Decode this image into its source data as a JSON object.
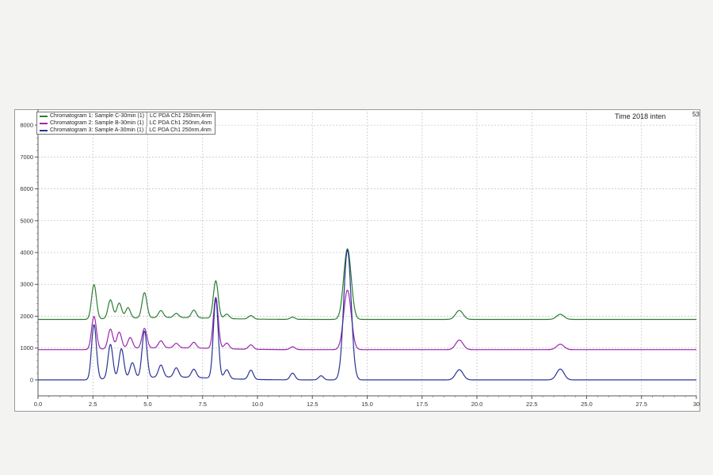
{
  "title": "Time 2018  inten",
  "corner_label": "53",
  "legend": [
    {
      "name": "Chromatogram 1: Sample C-30min (1)",
      "detail": "LC PDA Ch1 250nm,4nm",
      "color": "#2e7d32"
    },
    {
      "name": "Chromatogram 2: Sample B-30min (1)",
      "detail": "LC PDA Ch1 250nm,4nm",
      "color": "#9c27b0"
    },
    {
      "name": "Chromatogram 3: Sample A-30min (1)",
      "detail": "LC PDA Ch1 250nm,4nm",
      "color": "#283593"
    }
  ],
  "chart_data": {
    "type": "line",
    "title": "Time 2018  inten",
    "xlabel": "",
    "ylabel": "",
    "xlim": [
      0,
      30
    ],
    "ylim": [
      -500,
      8500
    ],
    "x_ticks": [
      "0.0",
      "2.5",
      "5.0",
      "7.5",
      "10.0",
      "12.5",
      "15.0",
      "17.5",
      "20.0",
      "22.5",
      "25.0",
      "27.5",
      "30"
    ],
    "y_ticks": [
      "0",
      "1000",
      "2000",
      "3000",
      "4000",
      "5000",
      "6000",
      "7000",
      "8000"
    ],
    "grid": true,
    "legend_position": "top-left",
    "series": [
      {
        "name": "Chromatogram 1: Sample C-30min (1)",
        "color": "#2e7d32",
        "baseline": 1900,
        "peaks": [
          {
            "t": 2.55,
            "h": 1080
          },
          {
            "t": 3.3,
            "h": 590
          },
          {
            "t": 3.7,
            "h": 480
          },
          {
            "t": 4.1,
            "h": 330
          },
          {
            "t": 4.85,
            "h": 790
          },
          {
            "t": 5.6,
            "h": 220
          },
          {
            "t": 6.3,
            "h": 130
          },
          {
            "t": 7.1,
            "h": 240
          },
          {
            "t": 8.1,
            "h": 1180
          },
          {
            "t": 8.6,
            "h": 140
          },
          {
            "t": 9.7,
            "h": 110
          },
          {
            "t": 11.6,
            "h": 70
          },
          {
            "t": 14.1,
            "h": 2220
          },
          {
            "t": 19.2,
            "h": 280
          },
          {
            "t": 23.8,
            "h": 160
          }
        ]
      },
      {
        "name": "Chromatogram 2: Sample B-30min (1)",
        "color": "#9c27b0",
        "baseline": 950,
        "peaks": [
          {
            "t": 2.55,
            "h": 1030
          },
          {
            "t": 3.3,
            "h": 620
          },
          {
            "t": 3.7,
            "h": 520
          },
          {
            "t": 4.2,
            "h": 340
          },
          {
            "t": 4.85,
            "h": 620
          },
          {
            "t": 5.6,
            "h": 220
          },
          {
            "t": 6.3,
            "h": 140
          },
          {
            "t": 7.1,
            "h": 180
          },
          {
            "t": 8.1,
            "h": 1610
          },
          {
            "t": 8.6,
            "h": 180
          },
          {
            "t": 9.7,
            "h": 140
          },
          {
            "t": 11.6,
            "h": 90
          },
          {
            "t": 14.1,
            "h": 1870
          },
          {
            "t": 19.2,
            "h": 300
          },
          {
            "t": 23.8,
            "h": 170
          }
        ]
      },
      {
        "name": "Chromatogram 3: Sample A-30min (1)",
        "color": "#283593",
        "baseline": 0,
        "peaks": [
          {
            "t": 2.55,
            "h": 1720
          },
          {
            "t": 3.3,
            "h": 1080
          },
          {
            "t": 3.8,
            "h": 930
          },
          {
            "t": 4.3,
            "h": 480
          },
          {
            "t": 4.85,
            "h": 1460
          },
          {
            "t": 5.6,
            "h": 380
          },
          {
            "t": 6.3,
            "h": 290
          },
          {
            "t": 7.1,
            "h": 260
          },
          {
            "t": 8.1,
            "h": 2490
          },
          {
            "t": 8.6,
            "h": 280
          },
          {
            "t": 9.7,
            "h": 290
          },
          {
            "t": 11.6,
            "h": 210
          },
          {
            "t": 12.9,
            "h": 130
          },
          {
            "t": 14.1,
            "h": 4080
          },
          {
            "t": 19.2,
            "h": 320
          },
          {
            "t": 23.8,
            "h": 340
          }
        ]
      }
    ]
  }
}
